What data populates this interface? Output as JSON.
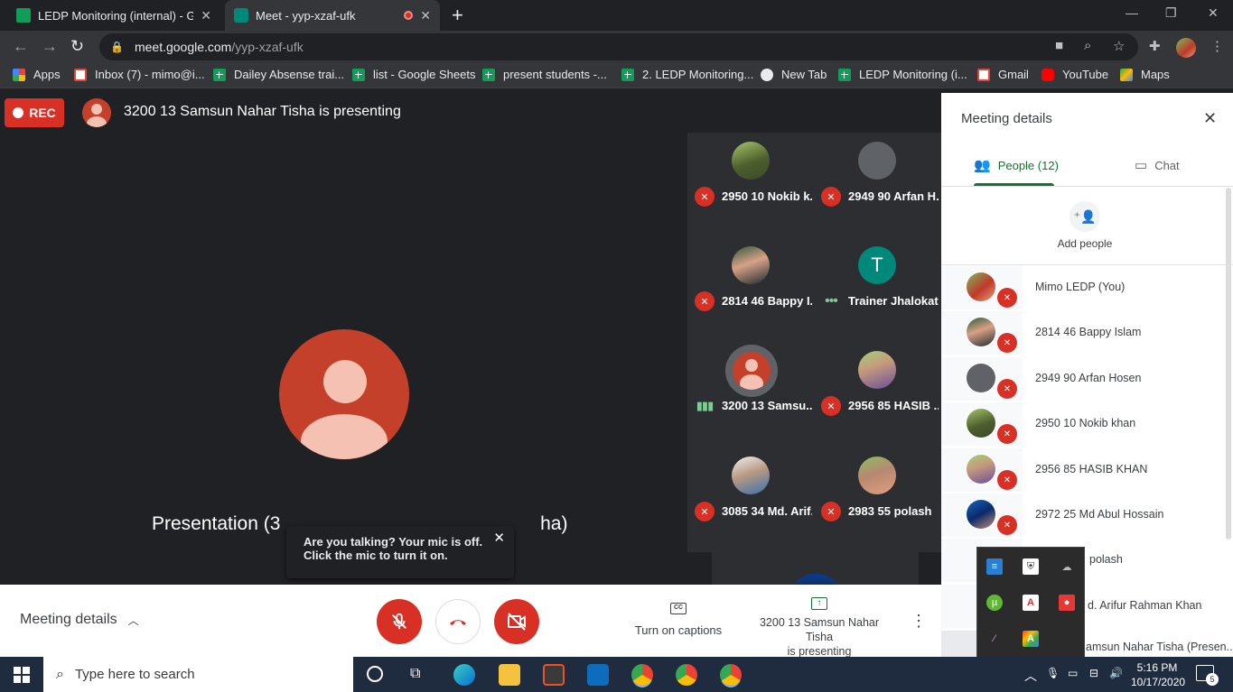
{
  "browser": {
    "tabs": [
      {
        "title": "LEDP Monitoring (internal) - Goo",
        "active": false
      },
      {
        "title": "Meet - yyp-xzaf-ufk",
        "active": true
      }
    ],
    "new_tab": "+",
    "address": {
      "host": "meet.google.com",
      "path": "/yyp-xzaf-ufk"
    },
    "bookmarks": [
      "Apps",
      "Inbox (7) - mimo@i...",
      "Dailey Absense trai...",
      "list - Google Sheets",
      "present students -...",
      "2. LEDP Monitoring...",
      "New Tab",
      "LEDP Monitoring (i...",
      "Gmail",
      "YouTube",
      "Maps"
    ]
  },
  "meet": {
    "rec_label": "REC",
    "presenting_title": "3200 13 Samsun Nahar Tisha is presenting",
    "presentation_label": "Presentation (3",
    "presentation_label_tail": "ha)",
    "toast": "Are you talking? Your mic is off. Click the mic to turn it on.",
    "tiles": [
      {
        "name": "2950 10 Nokib k...",
        "status": "muted"
      },
      {
        "name": "2949 90 Arfan H...",
        "status": "muted"
      },
      {
        "name": "2814 46 Bappy I...",
        "status": "muted"
      },
      {
        "name": "Trainer Jhalokat...",
        "status": "speaking",
        "letter": "T"
      },
      {
        "name": "3200 13 Samsu...",
        "status": "talking"
      },
      {
        "name": "2956 85 HASIB ...",
        "status": "muted"
      },
      {
        "name": "3085 34 Md. Arif...",
        "status": "muted"
      },
      {
        "name": "2983 55 polash",
        "status": "muted"
      }
    ],
    "controls": {
      "meeting_details": "Meeting details",
      "captions_label": "Turn on captions",
      "presenting_line1": "3200 13 Samsun Nahar Tisha",
      "presenting_line2": "is presenting"
    }
  },
  "side_panel": {
    "title": "Meeting details",
    "people_tab": "People (12)",
    "chat_tab": "Chat",
    "add_people": "Add people",
    "people": [
      "Mimo LEDP (You)",
      "2814 46 Bappy Islam",
      "2949 90 Arfan Hosen",
      "2950 10 Nokib khan",
      "2956 85 HASIB KHAN",
      "2972 25 Md Abul Hossain",
      "polash",
      "d. Arifur Rahman Khan",
      "amsun Nahar Tisha (Presen..."
    ]
  },
  "taskbar": {
    "search_placeholder": "Type here to search",
    "time": "5:16 PM",
    "date": "10/17/2020",
    "notification_count": "5"
  }
}
